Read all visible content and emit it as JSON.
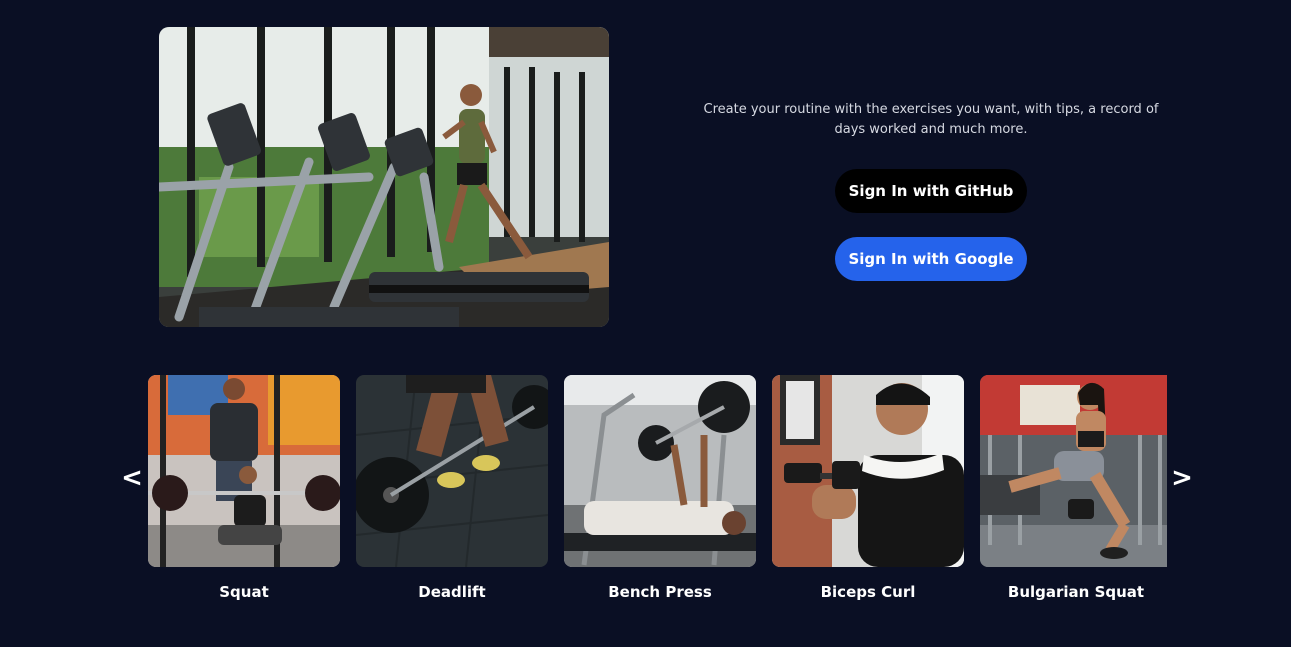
{
  "hero": {
    "image_alt": "Treadmills in a gym"
  },
  "intro": {
    "text": "Create your routine with the exercises you want, with tips, a record of days worked and much more."
  },
  "auth": {
    "github_label": "Sign In with GitHub",
    "google_label": "Sign In with Google"
  },
  "carousel": {
    "prev_label": "<",
    "next_label": ">",
    "items": [
      {
        "title": "Squat"
      },
      {
        "title": "Deadlift"
      },
      {
        "title": "Bench Press"
      },
      {
        "title": "Biceps Curl"
      },
      {
        "title": "Bulgarian Squat"
      }
    ]
  },
  "colors": {
    "background": "#0a0f24",
    "github_button": "#000000",
    "google_button": "#2563eb",
    "text": "#ffffff"
  }
}
